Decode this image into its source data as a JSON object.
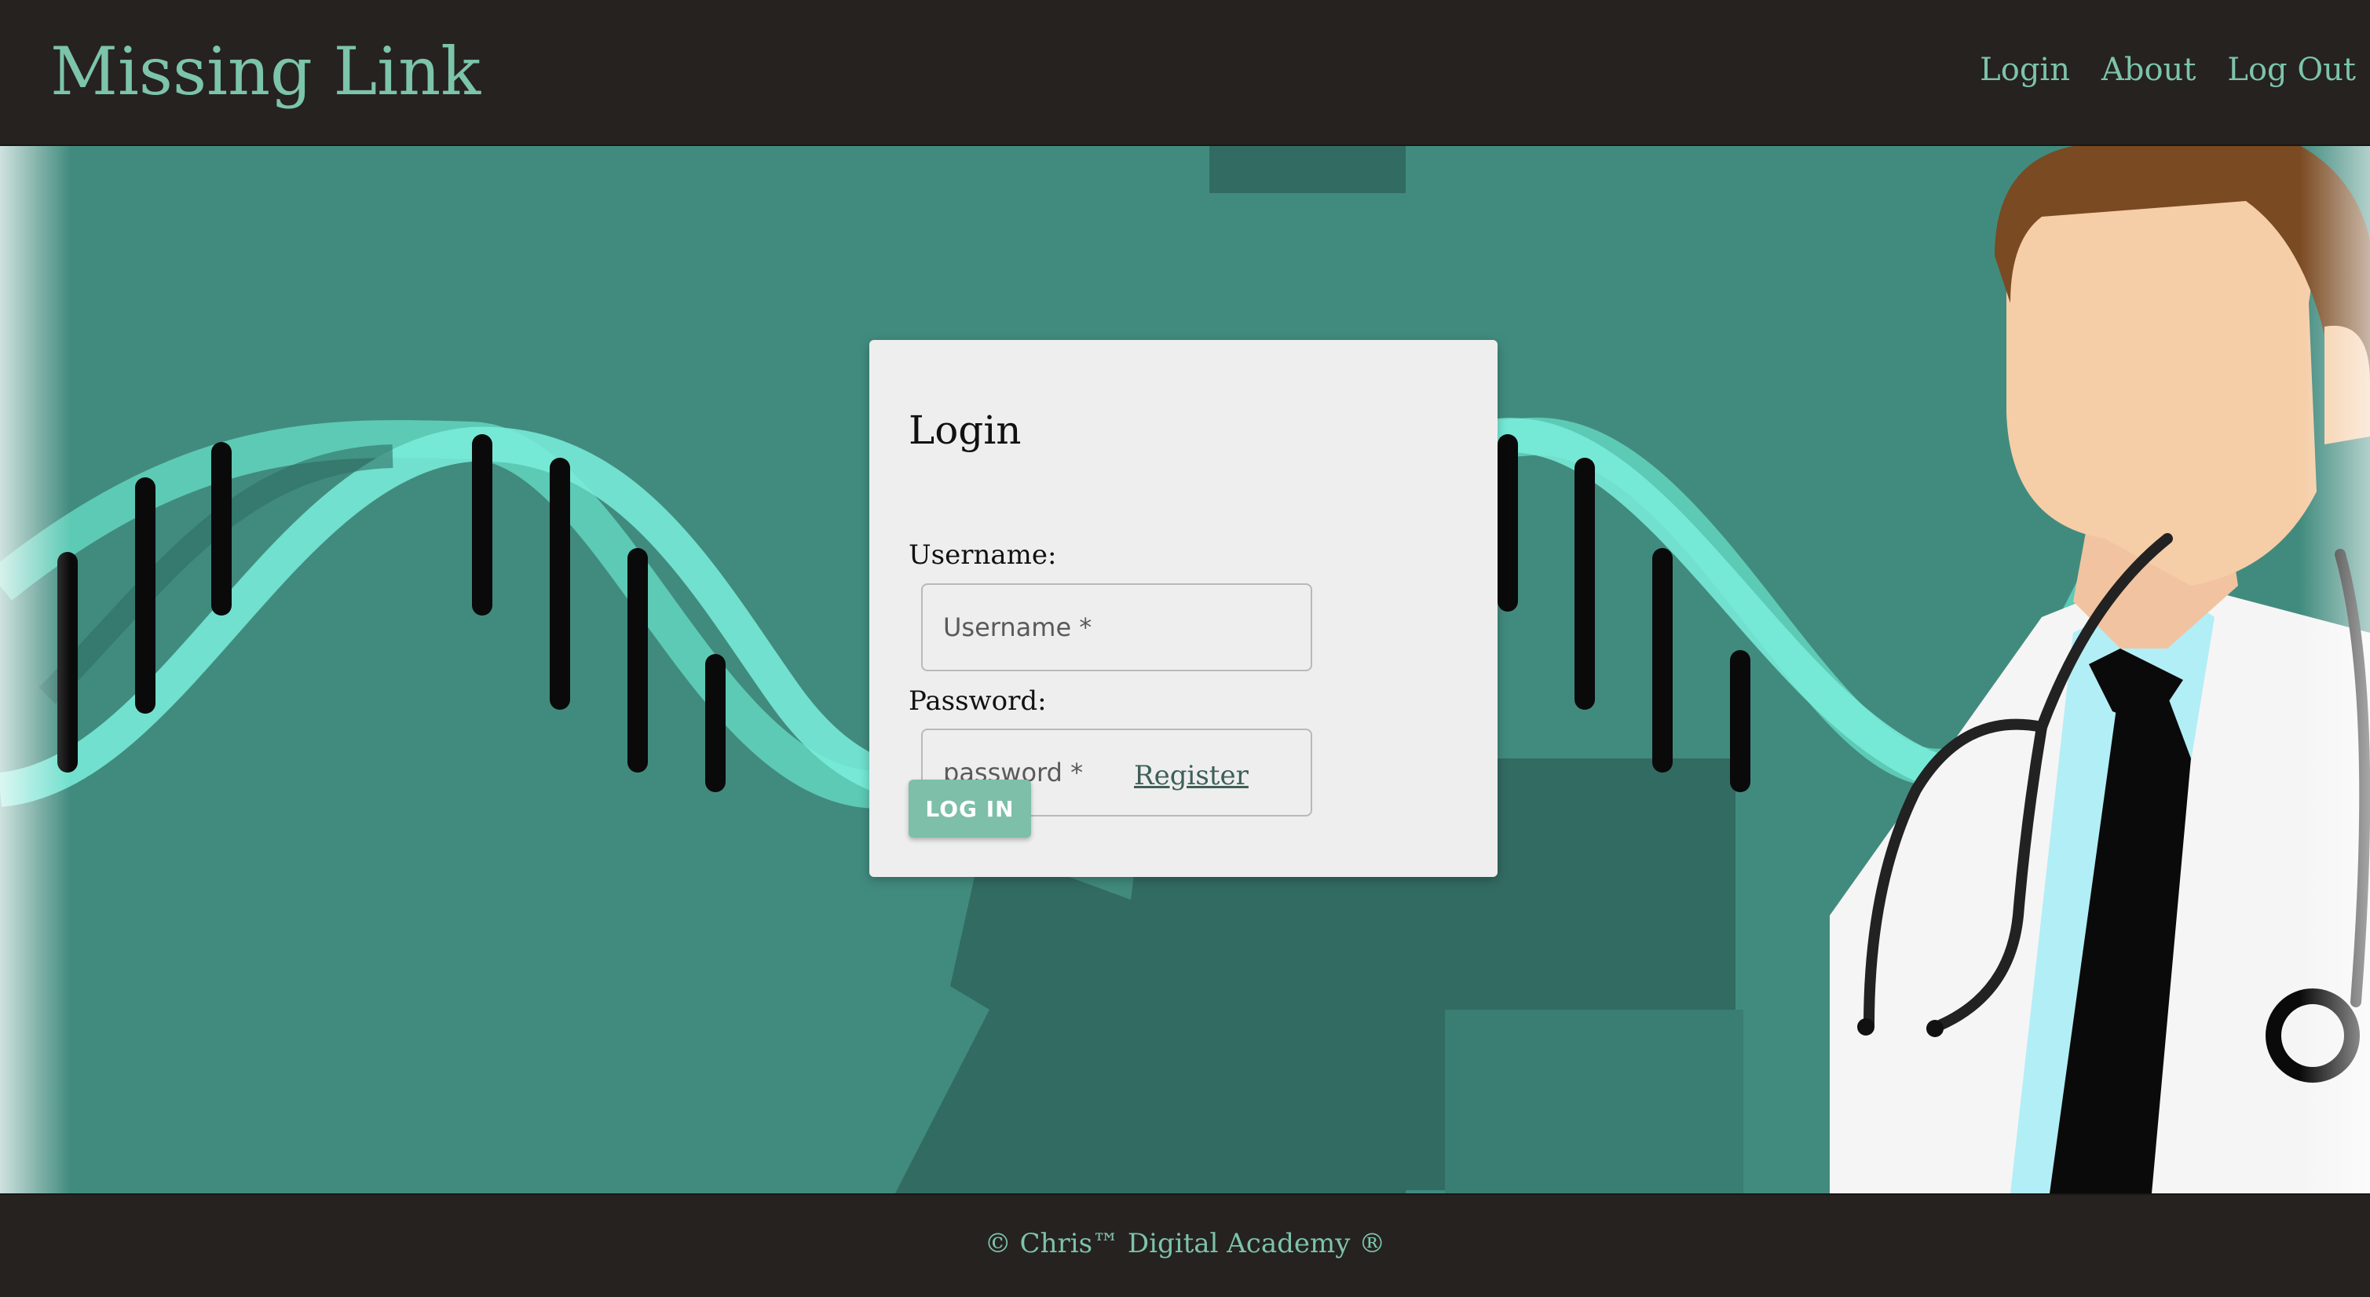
{
  "header": {
    "brand": "Missing Link",
    "nav": [
      "Login",
      "About",
      "Log Out"
    ]
  },
  "login": {
    "title": "Login",
    "username_label": "Username:",
    "username_placeholder": "Username *",
    "password_label": "Password:",
    "password_placeholder": "password *",
    "submit_label": "LOG IN",
    "register_link": "Register"
  },
  "footer": {
    "text": "© Chris™ Digital Academy ®"
  },
  "colors": {
    "accent": "#7cc4aa",
    "header_bg": "#262220",
    "hero_bg": "#418b7e",
    "card_bg": "#eeeeee",
    "button_bg": "#7dbfa8"
  },
  "icons": [
    "dna-helix-illustration",
    "doctor-illustration",
    "stethoscope-illustration"
  ]
}
